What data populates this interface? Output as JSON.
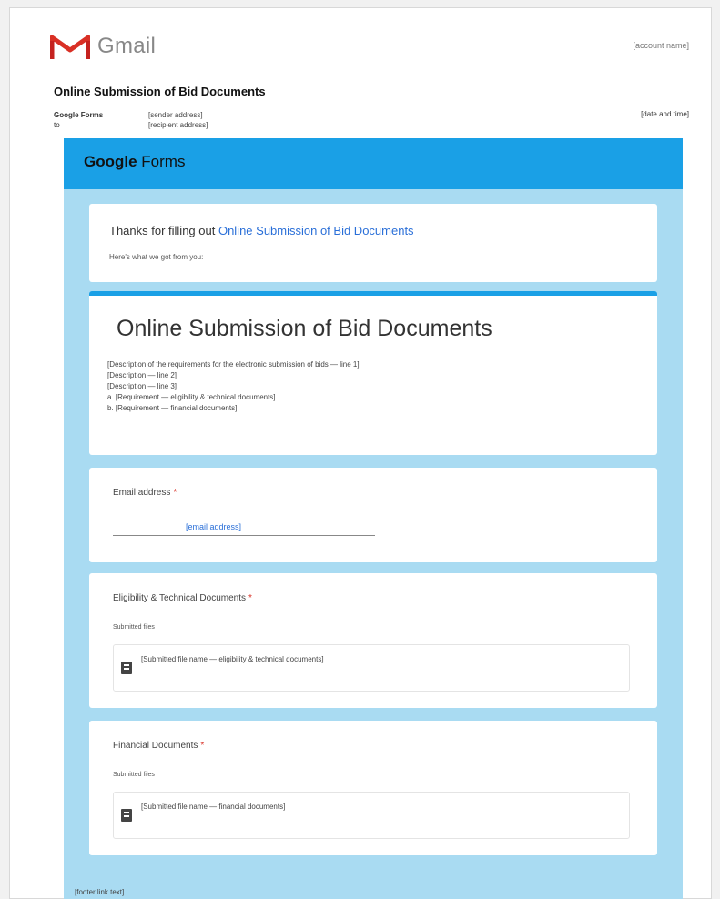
{
  "gmail": {
    "brand": "Gmail",
    "account": "[account name]"
  },
  "email": {
    "subject": "Online Submission of Bid Documents",
    "from_name": "Google Forms",
    "from_to": "to",
    "from_address_line1": "[sender address]",
    "from_address_line2": "[recipient address]",
    "date": "[date and time]"
  },
  "forms": {
    "header_brand_bold": "Google",
    "header_brand_rest": " Forms",
    "thanks_prefix": "Thanks for filling out ",
    "thanks_link": "Online Submission of Bid Documents",
    "thanks_sub": "Here's what we got from you:",
    "form_title": "Online Submission of Bid Documents",
    "description": [
      "[Description of the requirements for the electronic submission of bids — line 1]",
      "[Description — line 2]",
      "[Description — line 3]",
      "a. [Requirement — eligibility & technical documents]",
      "b. [Requirement — financial documents]"
    ],
    "questions": [
      {
        "label": "Email address",
        "required_mark": "*",
        "answer": "[email address]"
      },
      {
        "label": "Eligibility & Technical Documents",
        "required_mark": "*",
        "submitted_label": "Submitted files",
        "file_name": "[Submitted file name — eligibility & technical documents]"
      },
      {
        "label": "Financial Documents",
        "required_mark": "*",
        "submitted_label": "Submitted files",
        "file_name": "[Submitted file name — financial documents]"
      }
    ],
    "footer": "[footer link text]"
  },
  "colors": {
    "forms_header": "#1aa0e6",
    "forms_background": "#a9dbf2",
    "link": "#2a6fd8",
    "gmail_red": "#d93025"
  },
  "icons": [
    "gmail-logo-icon",
    "file-icon"
  ]
}
